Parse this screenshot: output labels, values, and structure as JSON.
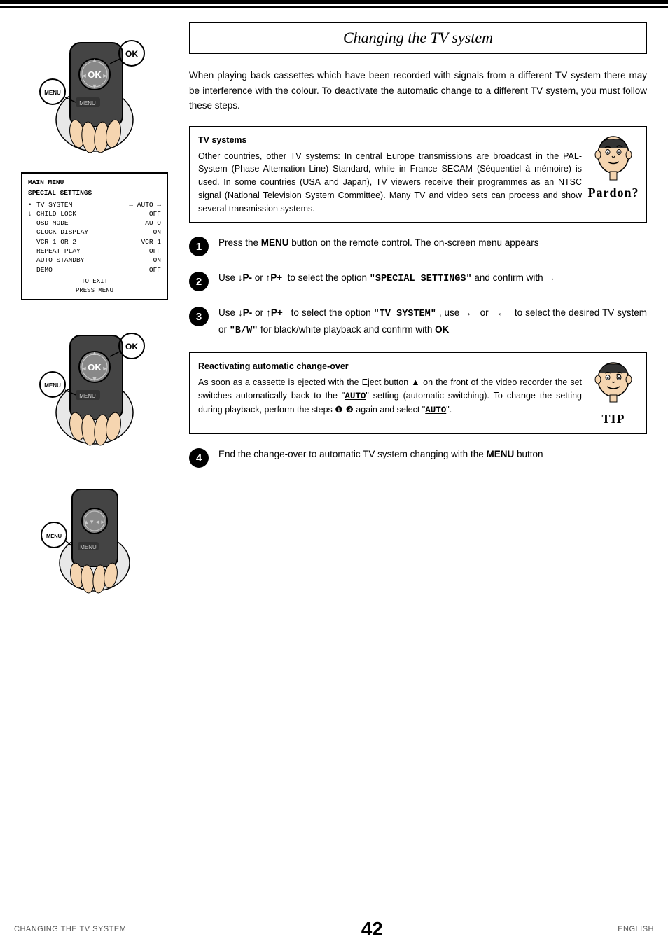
{
  "page": {
    "title": "Changing the TV system",
    "top_bars": [
      "thick",
      "thin"
    ],
    "bottom": {
      "left": "Changing the TV system",
      "center": "42",
      "right": "English"
    }
  },
  "content": {
    "intro": "When playing back cassettes which have been recorded with signals from a different TV system there may be interference with the colour. To deactivate the automatic change to a different TV system, you must follow these steps.",
    "info_box": {
      "title": "TV systems",
      "text": "Other countries, other TV systems: In central Europe transmissions are broadcast in the PAL-System (Phase Alternation Line) Standard, while in France SECAM (Séquentiel à mémoire) is used. In some countries (USA and Japan), TV viewers receive their programmes as an NTSC signal (National Television System Committee). Many TV and video sets can process and show several transmission systems.",
      "pardon_label": "Pardon?"
    },
    "steps": [
      {
        "number": "1",
        "text_parts": [
          {
            "type": "normal",
            "text": "Press the "
          },
          {
            "type": "bold",
            "text": "MENU"
          },
          {
            "type": "normal",
            "text": " button on the remote control. The on-screen menu appears"
          }
        ]
      },
      {
        "number": "2",
        "text_parts": [
          {
            "type": "normal",
            "text": "Use "
          },
          {
            "type": "bold",
            "text": "↓P-"
          },
          {
            "type": "normal",
            "text": " or "
          },
          {
            "type": "bold",
            "text": "↑P+"
          },
          {
            "type": "normal",
            "text": " to select the option "
          },
          {
            "type": "mono",
            "text": "\"SPECIAL SETTINGS\""
          },
          {
            "type": "normal",
            "text": " and confirm with "
          },
          {
            "type": "arrow",
            "text": "→"
          }
        ]
      },
      {
        "number": "3",
        "text_parts": [
          {
            "type": "normal",
            "text": "Use "
          },
          {
            "type": "bold",
            "text": "↓P-"
          },
          {
            "type": "normal",
            "text": " or "
          },
          {
            "type": "bold",
            "text": "↑P+"
          },
          {
            "type": "normal",
            "text": " to select the option "
          },
          {
            "type": "mono",
            "text": "\"TV SYSTEM\""
          },
          {
            "type": "normal",
            "text": " , use "
          },
          {
            "type": "arrow",
            "text": "→"
          },
          {
            "type": "normal",
            "text": "  or  "
          },
          {
            "type": "arrow",
            "text": "←"
          },
          {
            "type": "normal",
            "text": "  to select the desired TV system or "
          },
          {
            "type": "mono",
            "text": "\"B/W\""
          },
          {
            "type": "normal",
            "text": " for black/white playback and confirm with "
          },
          {
            "type": "bold",
            "text": "OK"
          }
        ]
      },
      {
        "number": "4",
        "text_parts": [
          {
            "type": "normal",
            "text": "End the change-over to automatic TV system changing with the "
          },
          {
            "type": "bold",
            "text": "MENU"
          },
          {
            "type": "normal",
            "text": " button"
          }
        ]
      }
    ],
    "tip_box": {
      "title": "Reactivating automatic change-over",
      "text": "As soon as a cassette is ejected with the Eject button ▲ on the front of the video recorder the set switches automatically back to the \"AUTO\" setting (automatic switching). To change the setting during playback, perform the steps ❶-❸ again and select \"AUTO\".",
      "tip_label": "TIP"
    }
  },
  "menu_screen": {
    "title_line1": "MAIN MENU",
    "title_line2": "SPECIAL SETTINGS",
    "rows": [
      {
        "bullet": "•",
        "label": "TV SYSTEM",
        "value": "← AUTO →"
      },
      {
        "bullet": "↓",
        "label": "CHILD LOCK",
        "value": "OFF"
      },
      {
        "bullet": "",
        "label": "OSD MODE",
        "value": "AUTO"
      },
      {
        "bullet": "",
        "label": "CLOCK DISPLAY",
        "value": "ON"
      },
      {
        "bullet": "",
        "label": "VCR 1 OR 2",
        "value": "VCR 1"
      },
      {
        "bullet": "",
        "label": "REPEAT PLAY",
        "value": "OFF"
      },
      {
        "bullet": "",
        "label": "AUTO STANDBY",
        "value": "ON"
      },
      {
        "bullet": "",
        "label": "DEMO",
        "value": "OFF"
      }
    ],
    "footer": "TO EXIT\nPRESS MENU"
  }
}
